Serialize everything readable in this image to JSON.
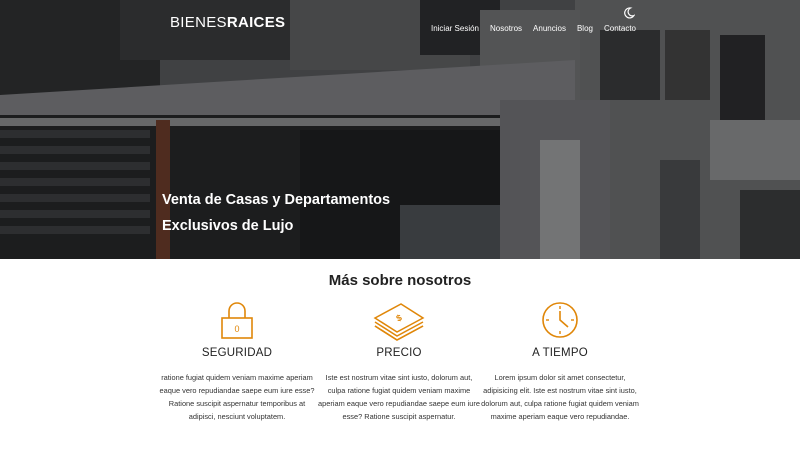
{
  "header": {
    "logo_light": "BIENES",
    "logo_bold": "RAICES",
    "nav": [
      "Iniciar Sesión",
      "Nosotros",
      "Anuncios",
      "Blog",
      "Contacto"
    ],
    "theme_icon": "moon-icon"
  },
  "hero": {
    "title_line1": "Venta de Casas y Departamentos",
    "title_line2": "Exclusivos de Lujo"
  },
  "about": {
    "title": "Más sobre nosotros",
    "features": [
      {
        "icon": "lock-icon",
        "title": "SEGURIDAD",
        "text": "ratione fugiat quidem veniam maxime aperiam eaque vero repudiandae saepe eum iure esse? Ratione suscipit aspernatur temporibus at adipisci, nesciunt voluptatem."
      },
      {
        "icon": "money-icon",
        "title": "PRECIO",
        "text": "Iste est nostrum vitae sint iusto, dolorum aut, culpa ratione fugiat quidem veniam maxime aperiam eaque vero repudiandae saepe eum iure esse? Ratione suscipit aspernatur."
      },
      {
        "icon": "clock-icon",
        "title": "A TIEMPO",
        "text": "Lorem ipsum dolor sit amet consectetur, adipisicing elit. Iste est nostrum vitae sint iusto, dolorum aut, culpa ratione fugiat quidem veniam maxime aperiam eaque vero repudiandae."
      }
    ]
  },
  "colors": {
    "accent": "#E08709",
    "text": "#222222",
    "hero_text": "#FFFFFF"
  }
}
